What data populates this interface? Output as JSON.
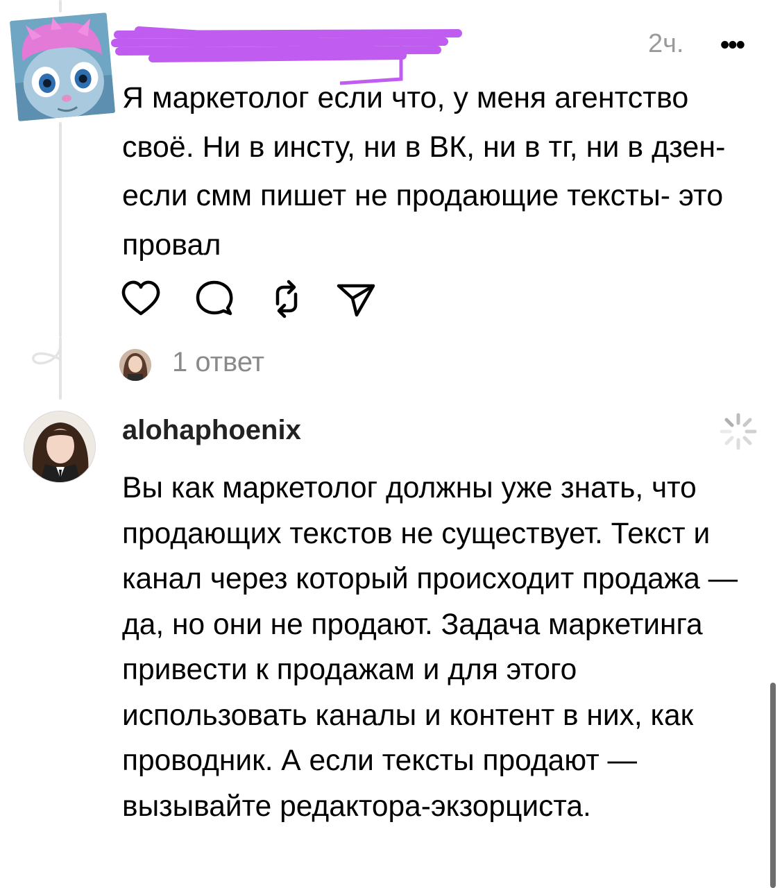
{
  "comments": [
    {
      "time": "2ч.",
      "more_label": "•••",
      "text": "Я маркетолог если что, у меня агентство своё. Ни в инсту, ни в ВК, ни в тг, ни в дзен- если смм пишет не продающие тексты- это провал",
      "replies_label": "1 ответ"
    },
    {
      "username": "alohaphoenix",
      "text": "Вы как маркетолог должны уже знать, что продающих текстов не существует. Текст и канал через который происходит продажа — да, но они не продают. Задача маркетинга привести к продажам и для этого использовать каналы и контент в них, как проводник. А если тексты продают — вызывайте редактора-экзорциста."
    }
  ],
  "icons": {
    "like": "heart-icon",
    "reply": "comment-icon",
    "repost": "repost-icon",
    "share": "send-icon",
    "loading": "loading-spinner-icon"
  },
  "colors": {
    "redaction": "#c05cf0",
    "muted_text": "#9a9a9a",
    "thread_line": "#e3e3e3"
  }
}
